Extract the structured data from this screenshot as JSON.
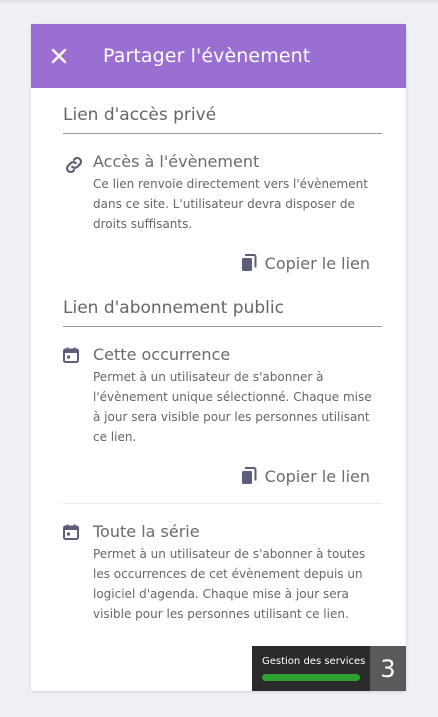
{
  "dialog": {
    "title": "Partager l'évènement",
    "close_icon": "close-icon"
  },
  "private_section": {
    "heading": "Lien d'accès privé",
    "item": {
      "icon": "link-icon",
      "title": "Accès à l'évènement",
      "description": "Ce lien renvoie directement vers l'évènement dans ce site. L'utilisateur devra disposer de droits suffisants."
    },
    "copy_label": "Copier le lien"
  },
  "public_section": {
    "heading": "Lien d'abonnement public",
    "items": [
      {
        "icon": "calendar-icon",
        "title": "Cette occurrence",
        "description": "Permet à un utilisateur de s'abonner à l'évènement unique sélectionné. Chaque mise à jour sera visible pour les personnes utilisant ce lien.",
        "copy_label": "Copier le lien"
      },
      {
        "icon": "calendar-icon",
        "title": "Toute la série",
        "description": "Permet à un utilisateur de s'abonner à toutes les occurrences de cet évènement depuis un logiciel d'agenda. Chaque mise à jour sera visible pour les personnes utilisant ce lien."
      }
    ]
  },
  "service_badge": {
    "label": "Gestion des services",
    "count": "3",
    "bar_color": "#2ea12e",
    "progress": 1.0
  },
  "colors": {
    "header": "#9b6fd1",
    "text": "#6b6b6b",
    "icon": "#5d5f7a"
  }
}
